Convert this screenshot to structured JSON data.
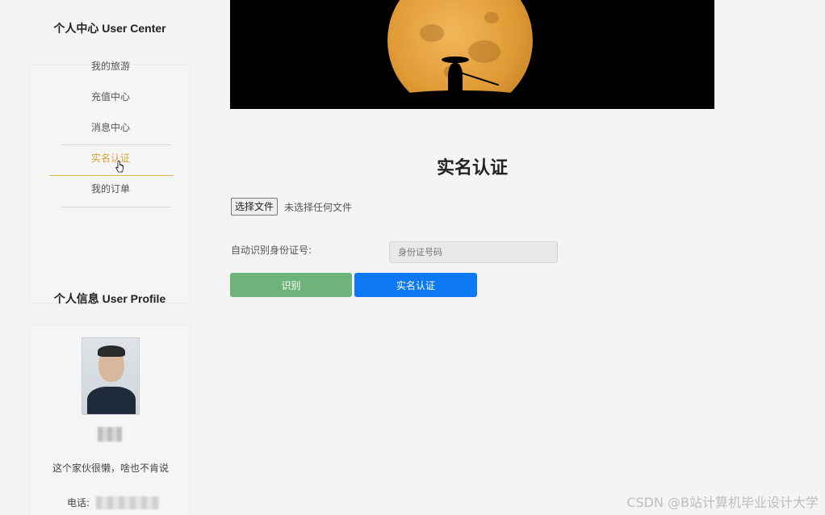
{
  "sidebar": {
    "user_center_title": "个人中心 User Center",
    "menu_items": [
      {
        "label": "我的旅游"
      },
      {
        "label": "充值中心"
      },
      {
        "label": "消息中心"
      },
      {
        "label": "实名认证",
        "active": true
      },
      {
        "label": "我的订单"
      }
    ],
    "user_profile_title": "个人信息 User Profile",
    "profile": {
      "bio": "这个家伙很懒，啥也不肯说",
      "phone_label": "电话:"
    }
  },
  "main": {
    "title": "实名认证",
    "file_button_label": "选择文件",
    "file_status": "未选择任何文件",
    "id_label": "自动识别身份证号:",
    "id_placeholder": "身份证号码",
    "identify_button": "识别",
    "verify_button": "实名认证"
  },
  "watermark": "CSDN @B站计算机毕业设计大学",
  "colors": {
    "active_menu": "#d9a23a",
    "identify_button": "#6db37a",
    "verify_button": "#0d79f5"
  }
}
